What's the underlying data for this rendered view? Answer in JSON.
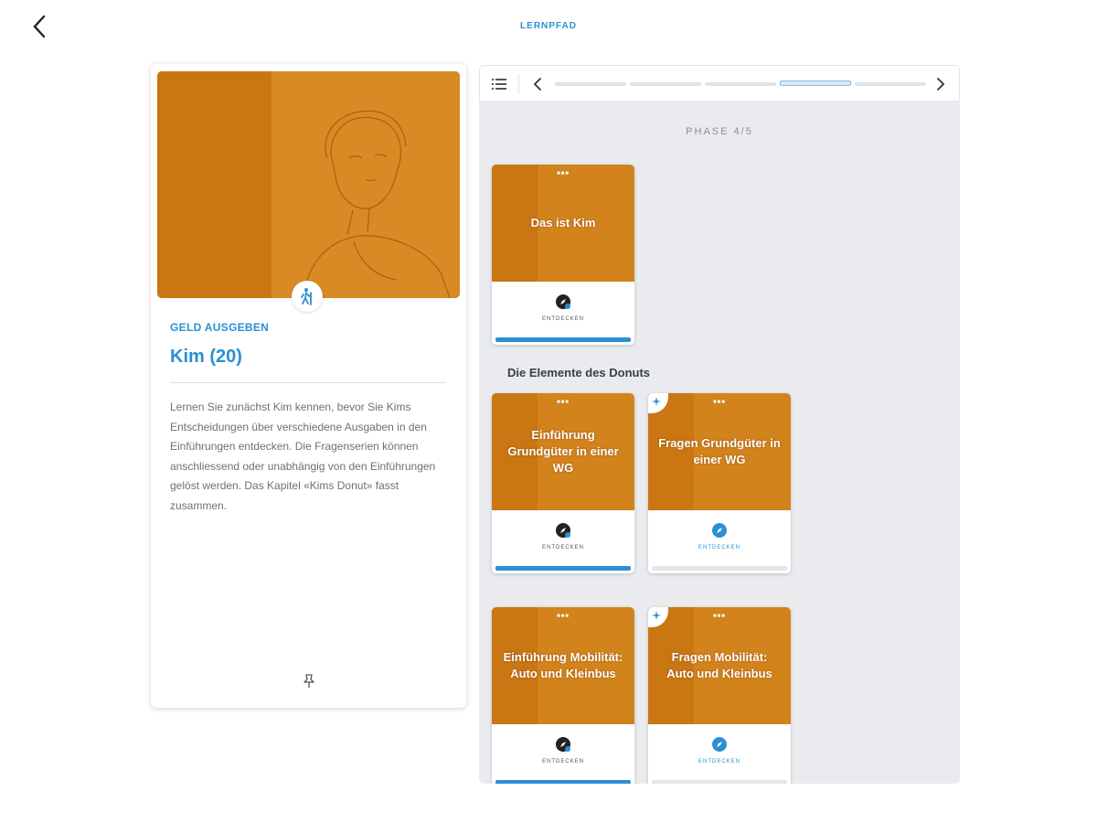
{
  "header": {
    "title": "LERNPFAD"
  },
  "info_card": {
    "topic": "GELD AUSGEBEN",
    "title": "Kim (20)",
    "description": "Lernen Sie zunächst Kim kennen, bevor Sie Kims Entscheidungen über verschiedene Ausgaben in den Einführungen entdecken. Die Fragenserien können anschliessend oder unabhängig von den Einführungen gelöst werden. Das Kapitel «Kims Donut» fasst zusammen."
  },
  "path": {
    "phase_label": "PHASE 4/5",
    "phase_count": 5,
    "active_phase": 4,
    "section_label": "Die Elemente des Donuts",
    "tiles": [
      {
        "title": "Das ist Kim",
        "action": "ENTDECKEN",
        "completed": true,
        "kind": "intro"
      },
      {
        "title": "Einführung Grundgüter in einer WG",
        "action": "ENTDECKEN",
        "completed": true,
        "kind": "intro"
      },
      {
        "title": "Fragen Grundgüter in einer WG",
        "action": "ENTDECKEN",
        "completed": false,
        "kind": "quiz"
      },
      {
        "title": "Einführung Mobilität: Auto und Kleinbus",
        "action": "ENTDECKEN",
        "completed": true,
        "kind": "intro"
      },
      {
        "title": "Fragen Mobilität: Auto und Kleinbus",
        "action": "ENTDECKEN",
        "completed": false,
        "kind": "quiz"
      }
    ]
  },
  "colors": {
    "accent": "#2b8fd3",
    "tile_orange": "#d3831c",
    "panel_bg": "#e9ebee"
  }
}
